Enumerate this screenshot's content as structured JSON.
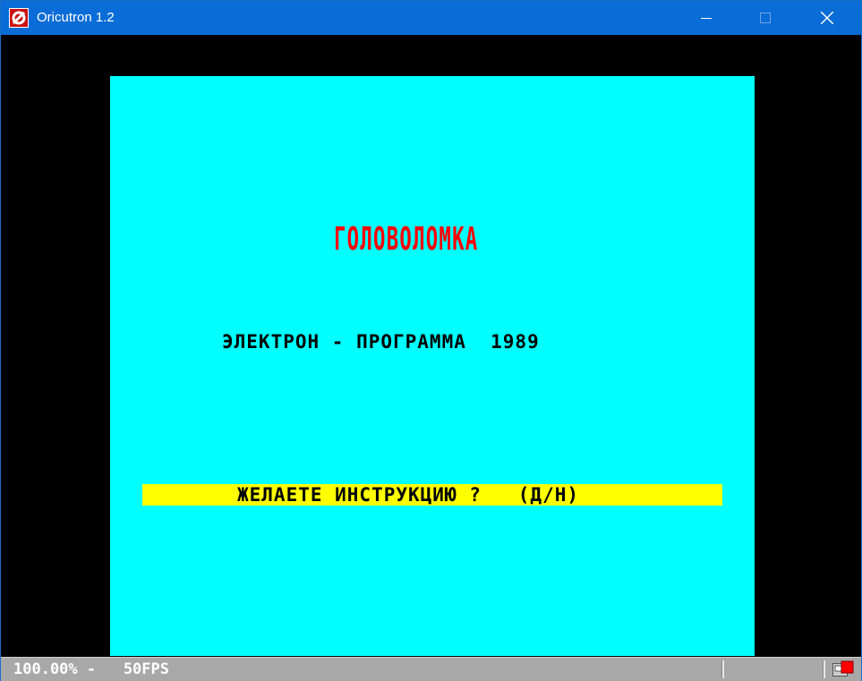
{
  "window": {
    "title": "Oricutron 1.2"
  },
  "icons": {
    "app": "oricutron-logo-icon",
    "minimize": "minimize-icon",
    "maximize": "maximize-icon",
    "close": "close-icon",
    "status": "disk-activity-icon"
  },
  "screen": {
    "title": "ГОЛОВОЛОМКА",
    "credit": "ЭЛЕКТРОН - ПРОГРАММА  1989",
    "prompt": "ЖЕЛАЕТЕ ИНСТРУКЦИЮ ?   (Д/Н)"
  },
  "statusbar": {
    "text": "100.00% -   50FPS"
  },
  "colors": {
    "titlebar": "#0a6cd6",
    "screen_bg": "#00ffff",
    "title_text": "#ff0000",
    "prompt_bg": "#ffff00",
    "statusbar_bg": "#a8a8a8",
    "activity_led": "#ff0000"
  }
}
